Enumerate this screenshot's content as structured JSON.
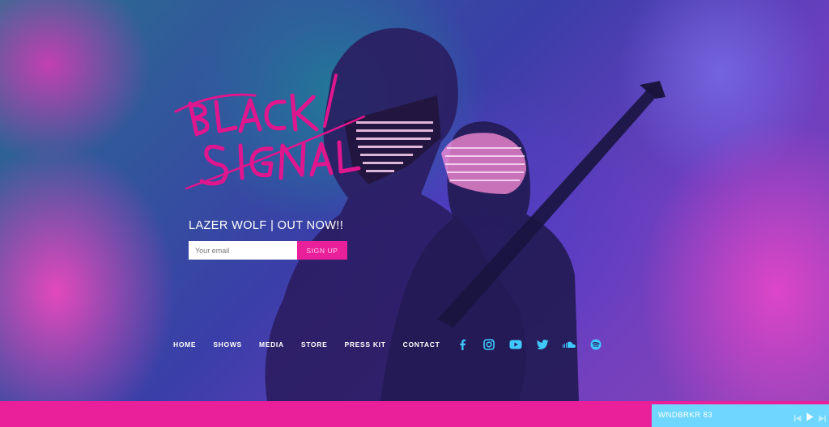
{
  "hero": {
    "logo_text": "BLACK SIGNAL",
    "tagline": "LAZER WOLF | OUT NOW!!",
    "email_placeholder": "Your email",
    "signup_label": "SIGN UP"
  },
  "nav": {
    "items": [
      "HOME",
      "SHOWS",
      "MEDIA",
      "STORE",
      "PRESS KIT",
      "CONTACT"
    ]
  },
  "social": {
    "icons": [
      "facebook-icon",
      "instagram-icon",
      "youtube-icon",
      "twitter-icon",
      "soundcloud-icon",
      "spotify-icon"
    ]
  },
  "player": {
    "track": "WNDBRKR 83",
    "controls": [
      "previous-icon",
      "play-icon",
      "next-icon"
    ]
  },
  "colors": {
    "accent": "#ea1f9a",
    "player_bg": "#6fd7ff",
    "logo": "#e0168e"
  }
}
